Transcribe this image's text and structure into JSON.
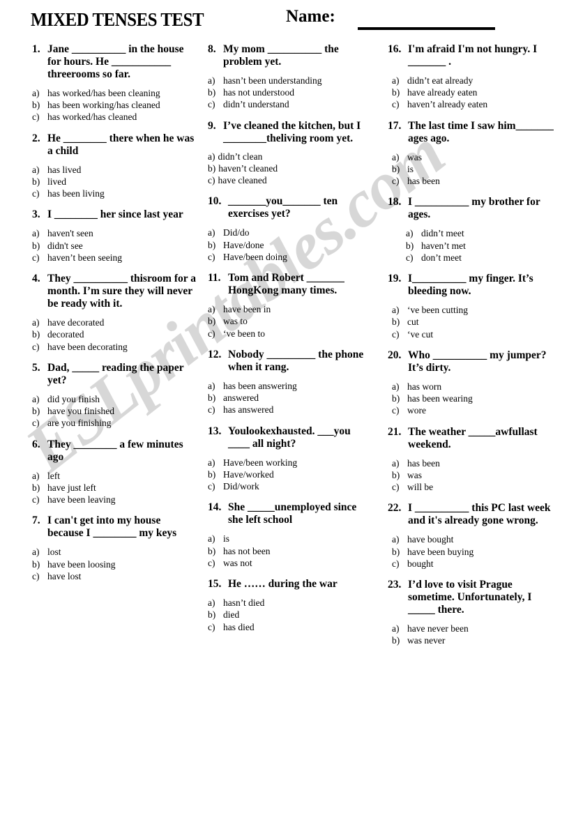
{
  "header": {
    "title": "MIXED TENSES TEST",
    "name_label": "Name:"
  },
  "watermark": {
    "text": "ESLprintables.com"
  },
  "columns": [
    {
      "id": "col-1",
      "questions": [
        {
          "number": "1.",
          "text": "Jane __________ in the house for hours. He ___________ threerooms so far.",
          "options": [
            {
              "key": "a)",
              "value": "has worked/has been cleaning"
            },
            {
              "key": "b)",
              "value": "has been working/has cleaned"
            },
            {
              "key": "c)",
              "value": "has worked/has cleaned"
            }
          ]
        },
        {
          "number": "2.",
          "text": "He ________ there when he was a child",
          "options": [
            {
              "key": "a)",
              "value": "has lived"
            },
            {
              "key": "b)",
              "value": "lived"
            },
            {
              "key": "c)",
              "value": "has been living"
            }
          ]
        },
        {
          "number": "3.",
          "text": "I ________ her since last year",
          "options": [
            {
              "key": "a)",
              "value": "haven't seen"
            },
            {
              "key": "b)",
              "value": "didn't see"
            },
            {
              "key": "c)",
              "value": "haven’t been seeing"
            }
          ]
        },
        {
          "number": "4.",
          "text": "They __________ thisroom for a month. I’m sure they will never be ready with it.",
          "options": [
            {
              "key": "a)",
              "value": "have decorated"
            },
            {
              "key": "b)",
              "value": "decorated"
            },
            {
              "key": "c)",
              "value": "have been decorating"
            }
          ]
        },
        {
          "number": "5.",
          "text": "Dad, _____ reading the paper yet?",
          "options": [
            {
              "key": "a)",
              "value": "did you finish"
            },
            {
              "key": "b)",
              "value": "have you finished"
            },
            {
              "key": "c)",
              "value": "are you finishing"
            }
          ]
        },
        {
          "number": "6.",
          "text": "They ________ a few minutes ago",
          "options": [
            {
              "key": "a)",
              "value": "left"
            },
            {
              "key": "b)",
              "value": "have just left"
            },
            {
              "key": "c)",
              "value": "have been leaving"
            }
          ]
        },
        {
          "number": "7.",
          "text": "I can't get into my house because I ________ my keys",
          "options": [
            {
              "key": "a)",
              "value": "lost"
            },
            {
              "key": "b)",
              "value": "have been loosing"
            },
            {
              "key": "c)",
              "value": "have lost"
            }
          ]
        }
      ]
    },
    {
      "id": "col-2",
      "questions": [
        {
          "number": "8.",
          "text": "My mom __________ the problem yet.",
          "options": [
            {
              "key": "a)",
              "value": "hasn’t been understanding"
            },
            {
              "key": "b)",
              "value": "has not understood"
            },
            {
              "key": "c)",
              "value": "didn’t understand"
            }
          ]
        },
        {
          "number": "9.",
          "text": "I’ve cleaned the kitchen, but I ________theliving room yet.",
          "options": [
            {
              "key": "a)",
              "value": "didn’t clean"
            },
            {
              "key": "b)",
              "value": "haven’t cleaned"
            },
            {
              "key": "c)",
              "value": "have cleaned"
            }
          ]
        },
        {
          "number": "10.",
          "text": "_______you_______ ten exercises yet?",
          "options": [
            {
              "key": "a)",
              "value": "Did/do"
            },
            {
              "key": "b)",
              "value": "Have/done"
            },
            {
              "key": "c)",
              "value": "Have/been doing"
            }
          ]
        },
        {
          "number": "11.",
          "text": "Tom and Robert _______ HongKong many times.",
          "options": [
            {
              "key": "a)",
              "value": "have been in"
            },
            {
              "key": "b)",
              "value": "was to"
            },
            {
              "key": "c)",
              "value": "‘ve been to"
            }
          ]
        },
        {
          "number": "12.",
          "text": "Nobody _________ the phone when it rang.",
          "options": [
            {
              "key": "a)",
              "value": "has been answering"
            },
            {
              "key": "b)",
              "value": "answered"
            },
            {
              "key": "c)",
              "value": "has answered"
            }
          ]
        },
        {
          "number": "13.",
          "text": "Youlookexhausted. ___you ____ all night?",
          "options": [
            {
              "key": "a)",
              "value": "Have/been working"
            },
            {
              "key": "b)",
              "value": "Have/worked"
            },
            {
              "key": "c)",
              "value": "Did/work"
            }
          ]
        },
        {
          "number": "14.",
          "text": "She _____unemployed since she left school",
          "options": [
            {
              "key": "a)",
              "value": "is"
            },
            {
              "key": "b)",
              "value": "has not been"
            },
            {
              "key": "c)",
              "value": "was not"
            }
          ]
        },
        {
          "number": "15.",
          "text": "He …… during the war",
          "options": [
            {
              "key": "a)",
              "value": "hasn’t died"
            },
            {
              "key": "b)",
              "value": "died"
            },
            {
              "key": "c)",
              "value": "has died"
            }
          ]
        }
      ]
    },
    {
      "id": "col-3",
      "questions": [
        {
          "number": "16.",
          "text": "I'm afraid I'm not hungry. I _______ .",
          "options": [
            {
              "key": "a)",
              "value": "didn’t eat already"
            },
            {
              "key": "b)",
              "value": "have already eaten"
            },
            {
              "key": "c)",
              "value": "haven’t already eaten"
            }
          ]
        },
        {
          "number": "17.",
          "text": "The last time I saw him_______ ages ago.",
          "options": [
            {
              "key": "a)",
              "value": "was"
            },
            {
              "key": "b)",
              "value": "is"
            },
            {
              "key": "c)",
              "value": "has been"
            }
          ]
        },
        {
          "number": "18.",
          "text": "I __________ my brother for ages.",
          "options": [
            {
              "key": "a)",
              "value": "didn’t meet"
            },
            {
              "key": "b)",
              "value": "haven’t met"
            },
            {
              "key": "c)",
              "value": "don’t meet"
            }
          ]
        },
        {
          "number": "19.",
          "text": "I__________ my finger. It’s bleeding now.",
          "options": [
            {
              "key": "a)",
              "value": "‘ve been cutting"
            },
            {
              "key": "b)",
              "value": "cut"
            },
            {
              "key": "c)",
              "value": "‘ve cut"
            }
          ]
        },
        {
          "number": "20.",
          "text": "Who __________ my jumper? It’s dirty.",
          "options": [
            {
              "key": "a)",
              "value": "has worn"
            },
            {
              "key": "b)",
              "value": "has been wearing"
            },
            {
              "key": "c)",
              "value": "wore"
            }
          ]
        },
        {
          "number": "21.",
          "text": "The weather _____awfullast weekend.",
          "options": [
            {
              "key": "a)",
              "value": "has been"
            },
            {
              "key": "b)",
              "value": "was"
            },
            {
              "key": "c)",
              "value": "will be"
            }
          ]
        },
        {
          "number": "22.",
          "text": "I __________ this PC last week and it's already gone wrong.",
          "options": [
            {
              "key": "a)",
              "value": "have bought"
            },
            {
              "key": "b)",
              "value": "have been buying"
            },
            {
              "key": "c)",
              "value": "bought"
            }
          ]
        },
        {
          "number": "23.",
          "text": "I’d love to visit Prague sometime. Unfortunately, I _____ there.",
          "options": [
            {
              "key": "a)",
              "value": "have never been"
            },
            {
              "key": "b)",
              "value": "was never"
            }
          ]
        }
      ]
    }
  ]
}
